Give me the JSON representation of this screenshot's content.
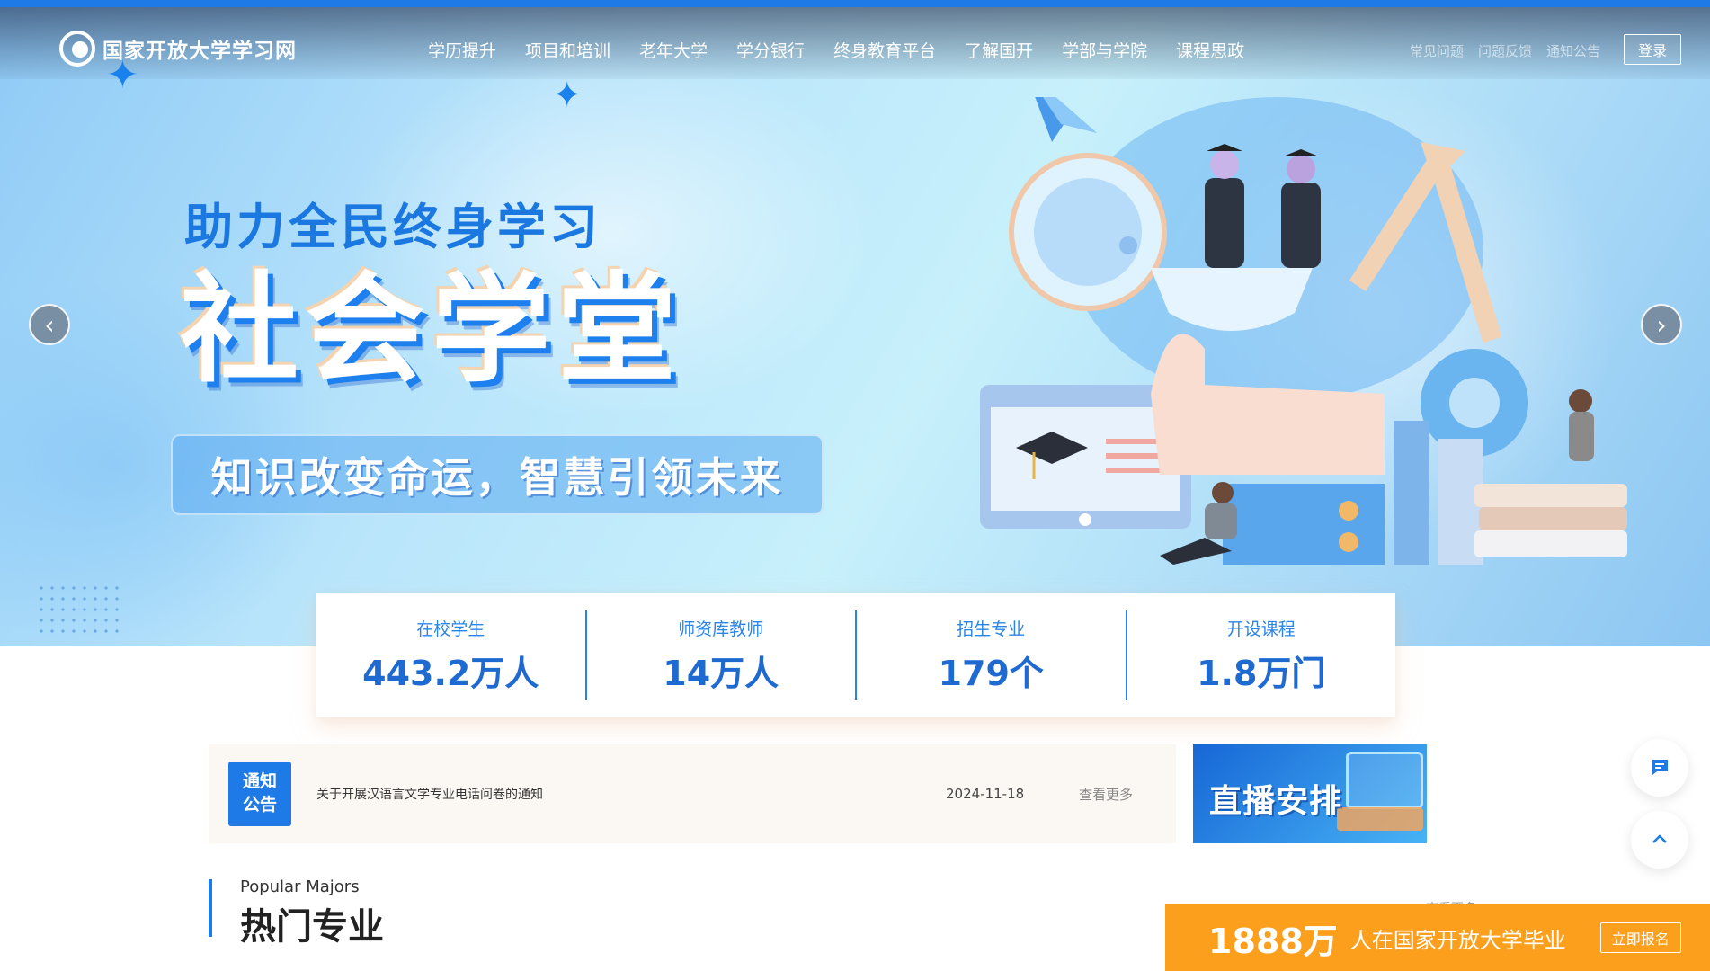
{
  "header": {
    "logo_text": "国家开放大学学习网",
    "nav": [
      "学历提升",
      "项目和培训",
      "老年大学",
      "学分银行",
      "终身教育平台",
      "了解国开",
      "学部与学院",
      "课程思政"
    ],
    "util_links": [
      "常见问题",
      "问题反馈",
      "通知公告"
    ],
    "login_label": "登录"
  },
  "hero": {
    "slogan": "助力全民终身学习",
    "title": "社会学堂",
    "tagline": "知识改变命运，智慧引领未来",
    "prev_icon": "chevron-left-icon",
    "next_icon": "chevron-right-icon"
  },
  "stats": [
    {
      "label": "在校学生",
      "value": "443.2万人"
    },
    {
      "label": "师资库教师",
      "value": "14万人"
    },
    {
      "label": "招生专业",
      "value": "179个"
    },
    {
      "label": "开设课程",
      "value": "1.8万门"
    }
  ],
  "notice": {
    "badge_line1": "通知",
    "badge_line2": "公告",
    "text": "关于开展汉语言文学专业电话问卷的通知",
    "date": "2024-11-18",
    "more": "查看更多"
  },
  "live": {
    "title": "直播安排"
  },
  "section": {
    "en": "Popular Majors",
    "cn": "热门专业",
    "more": "查看更多"
  },
  "enroll": {
    "number": "1888万",
    "text": "人在国家开放大学毕业",
    "button": "立即报名"
  },
  "colors": {
    "primary": "#1e7ae6",
    "orange": "#fb9f1c",
    "notice_bg": "#fbf7f2"
  }
}
